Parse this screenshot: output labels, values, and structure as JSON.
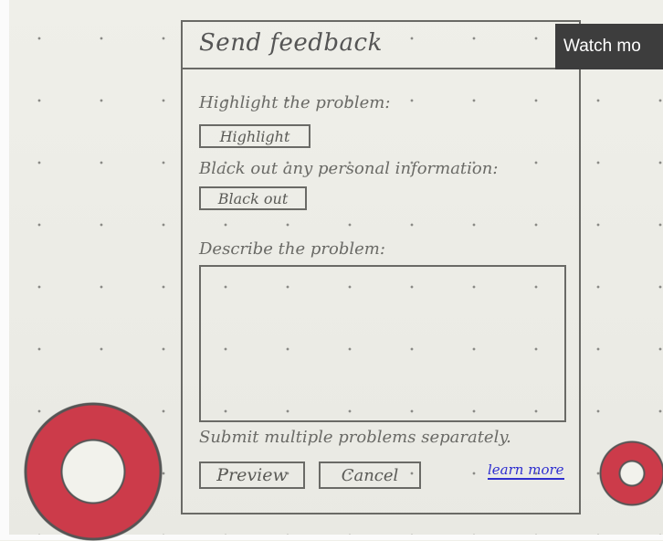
{
  "dialog": {
    "title": "Send feedback",
    "highlight_label": "Highlight the problem:",
    "highlight_button": "Highlight",
    "blackout_label": "Black out any personal information:",
    "blackout_button": "Black out",
    "describe_label": "Describe the problem:",
    "description_value": "",
    "hint": "Submit multiple problems separately.",
    "preview_button": "Preview",
    "cancel_button": "Cancel",
    "learn_more_link": "learn more"
  },
  "overlay": {
    "watch_more_label": "Watch mo"
  },
  "colors": {
    "background": "#ecece6",
    "ink": "#6a6a66",
    "link": "#2e2ed0",
    "donut": "#cc3b4a",
    "watch_button_bg": "#3d3d3d"
  }
}
